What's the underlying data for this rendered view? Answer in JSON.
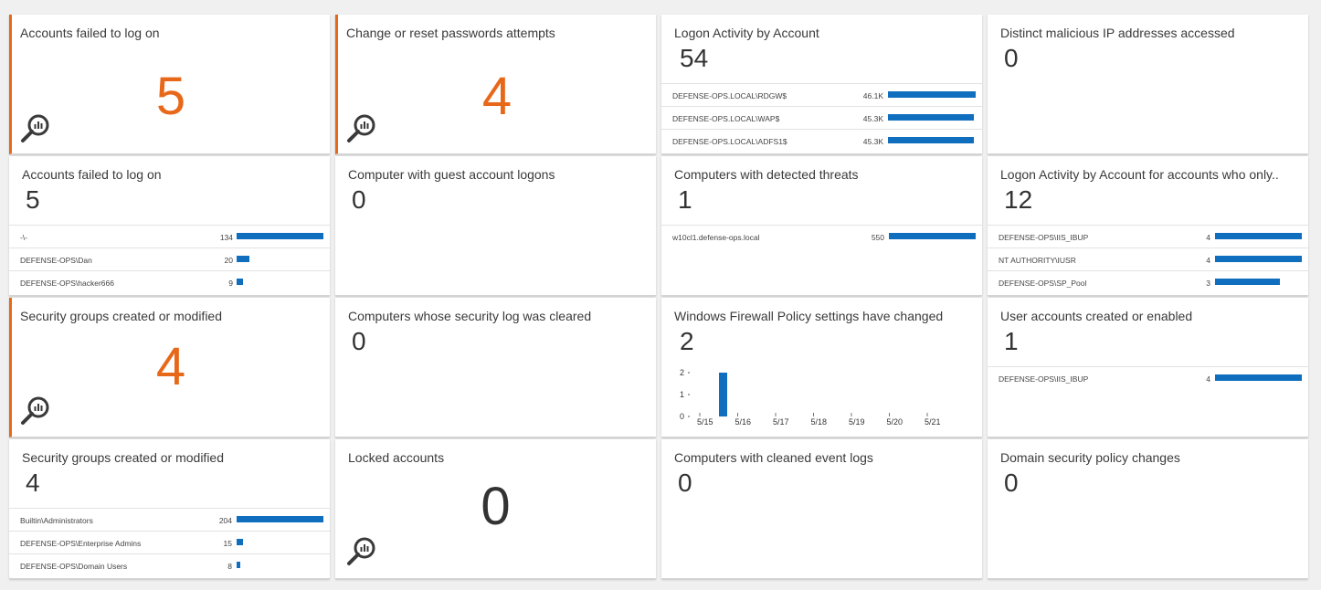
{
  "colors": {
    "accent": "#e8681a",
    "bar": "#106ebe",
    "background": "#f0f0f0"
  },
  "tiles": {
    "t1": {
      "title": "Accounts failed to log on",
      "value": "5",
      "icon": "magnifier-chart-icon"
    },
    "t2": {
      "title": "Change or reset passwords attempts",
      "value": "4",
      "icon": "magnifier-chart-icon"
    },
    "t3": {
      "title": "Logon Activity by Account",
      "value": "54",
      "rows": [
        {
          "name": "DEFENSE-OPS.LOCAL\\RDGW$",
          "value": "46.1K",
          "fraction": 1.0
        },
        {
          "name": "DEFENSE-OPS.LOCAL\\WAP$",
          "value": "45.3K",
          "fraction": 0.98
        },
        {
          "name": "DEFENSE-OPS.LOCAL\\ADFS1$",
          "value": "45.3K",
          "fraction": 0.98
        }
      ]
    },
    "t4": {
      "title": "Distinct malicious IP addresses accessed",
      "value": "0"
    },
    "t5": {
      "title": "Accounts failed to log on",
      "value": "5",
      "rows": [
        {
          "name": "-\\-",
          "value": "134",
          "fraction": 1.0
        },
        {
          "name": "DEFENSE-OPS\\Dan",
          "value": "20",
          "fraction": 0.15
        },
        {
          "name": "DEFENSE-OPS\\hacker666",
          "value": "9",
          "fraction": 0.07
        }
      ]
    },
    "t6": {
      "title": "Computer with guest account logons",
      "value": "0"
    },
    "t7": {
      "title": "Computers with detected threats",
      "value": "1",
      "rows": [
        {
          "name": "w10cl1.defense-ops.local",
          "value": "550",
          "fraction": 1.0
        }
      ]
    },
    "t8": {
      "title": "Logon Activity by Account for accounts who only..",
      "value": "12",
      "rows": [
        {
          "name": "DEFENSE-OPS\\IIS_IBUP",
          "value": "4",
          "fraction": 1.0
        },
        {
          "name": "NT AUTHORITY\\IUSR",
          "value": "4",
          "fraction": 1.0
        },
        {
          "name": "DEFENSE-OPS\\SP_Pool",
          "value": "3",
          "fraction": 0.75
        }
      ]
    },
    "t9": {
      "title": "Security groups created or modified",
      "value": "4",
      "icon": "magnifier-chart-icon"
    },
    "t10": {
      "title": "Computers whose security log was cleared",
      "value": "0"
    },
    "t11": {
      "title": "Windows Firewall Policy settings have changed",
      "value": "2"
    },
    "t12": {
      "title": "User accounts created or enabled",
      "value": "1",
      "rows": [
        {
          "name": "DEFENSE-OPS\\IIS_IBUP",
          "value": "4",
          "fraction": 1.0
        }
      ]
    },
    "t13": {
      "title": "Security groups created or modified",
      "value": "4",
      "rows": [
        {
          "name": "Builtin\\Administrators",
          "value": "204",
          "fraction": 1.0
        },
        {
          "name": "DEFENSE-OPS\\Enterprise Admins",
          "value": "15",
          "fraction": 0.07
        },
        {
          "name": "DEFENSE-OPS\\Domain Users",
          "value": "8",
          "fraction": 0.04
        }
      ]
    },
    "t14": {
      "title": "Locked accounts",
      "value": "0",
      "icon": "magnifier-chart-icon"
    },
    "t15": {
      "title": "Computers with cleaned event logs",
      "value": "0"
    },
    "t16": {
      "title": "Domain security policy changes",
      "value": "0"
    }
  },
  "chart_data": {
    "type": "bar",
    "categories": [
      "5/15",
      "5/16",
      "5/17",
      "5/18",
      "5/19",
      "5/20",
      "5/21"
    ],
    "values": [
      2,
      0,
      0,
      0,
      0,
      0,
      0
    ],
    "ylim": [
      0,
      2
    ],
    "yticks": [
      "0",
      "1",
      "2"
    ],
    "title": "",
    "xlabel": "",
    "ylabel": "",
    "grid": false
  }
}
